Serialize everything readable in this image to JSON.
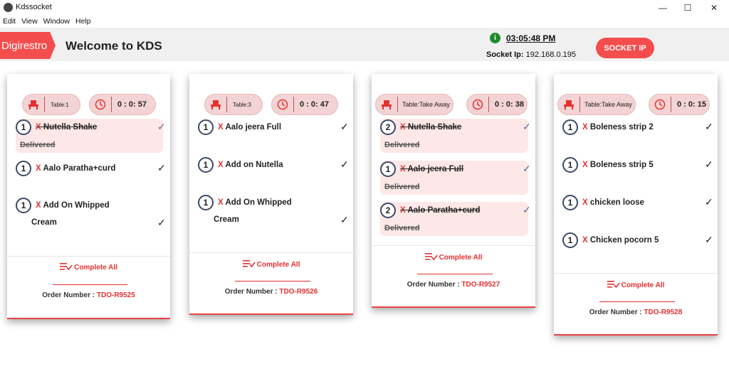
{
  "window": {
    "title": "Kdssocket",
    "min": "—",
    "max": "☐",
    "close": "✕"
  },
  "menu": [
    "Edit",
    "View",
    "Window",
    "Help"
  ],
  "header": {
    "brand": "Digirestro",
    "welcome": "Welcome to KDS",
    "time": "03:05:48 PM",
    "socket_label": "Socket Ip:",
    "socket_ip": "192.168.0.195",
    "socket_button": "SOCKET IP"
  },
  "colors": {
    "accent": "#f44d4d",
    "status_ok": "#1e8a2c"
  },
  "orders": [
    {
      "table": "Table:1",
      "timer": "0 : 0: 57",
      "items": [
        {
          "qty": "1",
          "x": "X",
          "name": "Nutella Shake",
          "delivered": "Delivered",
          "done": true
        },
        {
          "qty": "1",
          "x": "X",
          "name": "Aalo Paratha+curd",
          "done": false
        },
        {
          "qty": "1",
          "x": "X",
          "name": "Add On Whipped",
          "name2": "Cream",
          "done": false
        }
      ],
      "complete_label": "Complete All",
      "order_label": "Order Number :",
      "order_number": "TDO-R9525"
    },
    {
      "table": "Table:3",
      "timer": "0 : 0: 47",
      "items": [
        {
          "qty": "1",
          "x": "X",
          "name": "Aalo jeera Full",
          "done": false
        },
        {
          "qty": "1",
          "x": "X",
          "name": "Add on Nutella",
          "done": false
        },
        {
          "qty": "1",
          "x": "X",
          "name": "Add On Whipped",
          "name2": "Cream",
          "done": false
        }
      ],
      "complete_label": "Complete All",
      "order_label": "Order Number :",
      "order_number": "TDO-R9526"
    },
    {
      "table": "Table:Take Away",
      "timer": "0 : 0: 38",
      "items": [
        {
          "qty": "2",
          "x": "X",
          "name": "Nutella Shake",
          "delivered": "Delivered",
          "done": true
        },
        {
          "qty": "1",
          "x": "X",
          "name": "Aalo jeera Full",
          "delivered": "Delivered",
          "done": true
        },
        {
          "qty": "2",
          "x": "X",
          "name": "Aalo Paratha+curd",
          "delivered": "Delivered",
          "done": true
        }
      ],
      "complete_label": "Complete All",
      "order_label": "Order Number :",
      "order_number": "TDO-R9527"
    },
    {
      "table": "Table:Take Away",
      "timer": "0 : 0: 15",
      "items": [
        {
          "qty": "1",
          "x": "X",
          "name": "Boleness strip 2",
          "done": false
        },
        {
          "qty": "1",
          "x": "X",
          "name": "Boleness strip 5",
          "done": false
        },
        {
          "qty": "1",
          "x": "X",
          "name": "chicken loose",
          "done": false
        },
        {
          "qty": "1",
          "x": "X",
          "name": "Chicken pocorn 5",
          "done": false
        }
      ],
      "complete_label": "Complete All",
      "order_label": "Order Number :",
      "order_number": "TDO-R9528"
    }
  ]
}
